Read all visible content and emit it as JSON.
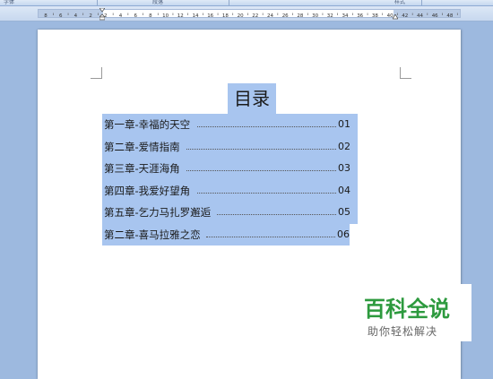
{
  "ribbon": {
    "group_labels": [
      "字体",
      "段落",
      "样式"
    ]
  },
  "ruler": {
    "ticks": [
      "8",
      "6",
      "4",
      "2",
      "2",
      "4",
      "6",
      "8",
      "10",
      "12",
      "14",
      "16",
      "18",
      "20",
      "22",
      "24",
      "26",
      "28",
      "30",
      "32",
      "34",
      "36",
      "38",
      "40",
      "42",
      "44",
      "46",
      "48"
    ]
  },
  "document": {
    "toc_title": "目录",
    "entries": [
      {
        "title": "第一章-幸福的天空",
        "page": "01"
      },
      {
        "title": "第二章-爱情指南",
        "page": "02"
      },
      {
        "title": "第三章-天涯海角",
        "page": "03"
      },
      {
        "title": "第四章-我爱好望角",
        "page": "04"
      },
      {
        "title": "第五章-乞力马扎罗邂逅",
        "page": "05"
      },
      {
        "title": "第二章-喜马拉雅之恋",
        "page": "06"
      }
    ]
  },
  "watermark": {
    "brand": "百科全说",
    "slogan": "助你轻松解决"
  }
}
